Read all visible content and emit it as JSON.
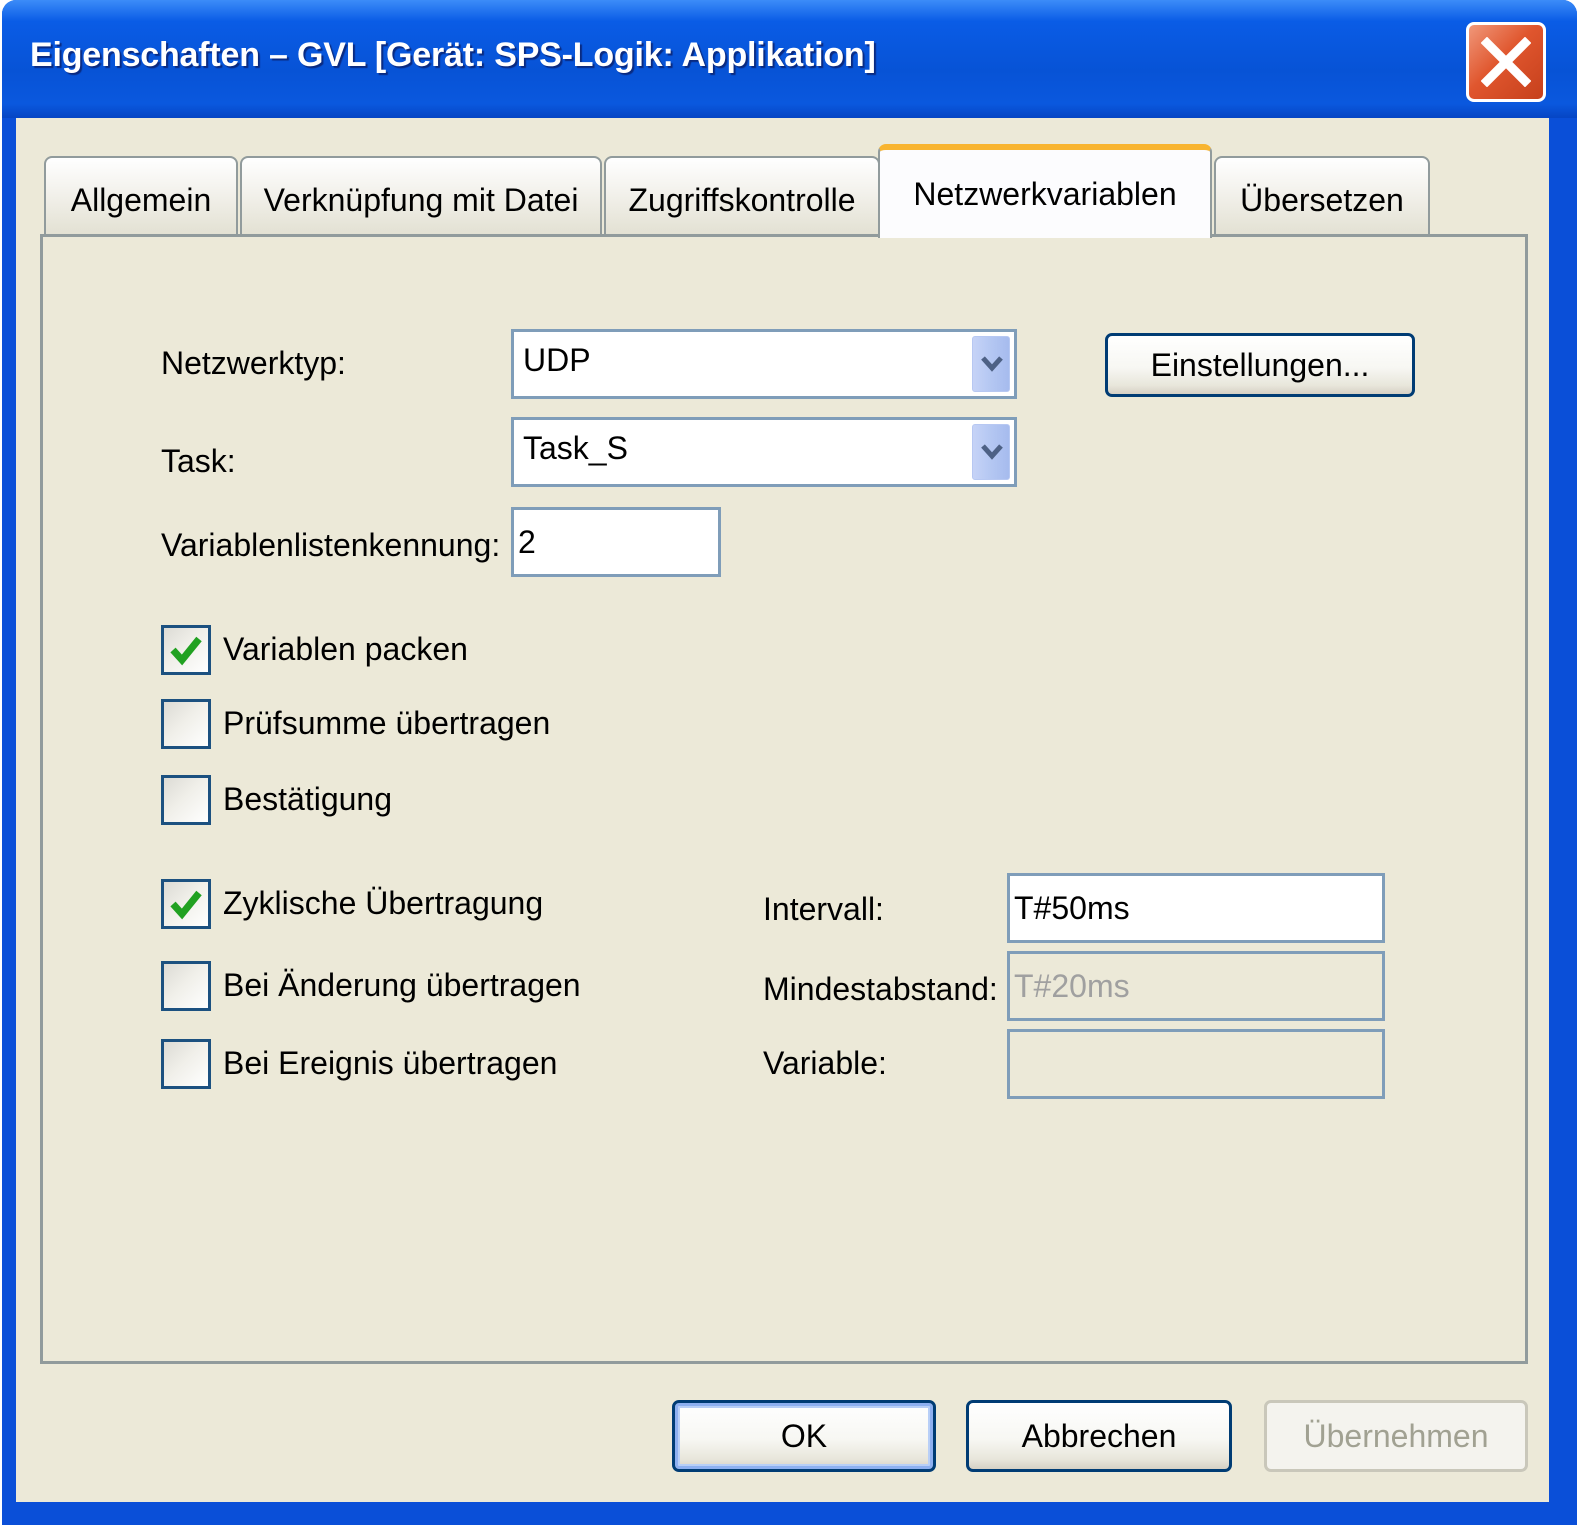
{
  "window": {
    "title": "Eigenschaften – GVL [Gerät: SPS-Logik: Applikation]"
  },
  "tabs": [
    {
      "label": "Allgemein",
      "active": false
    },
    {
      "label": "Verknüpfung mit Datei",
      "active": false
    },
    {
      "label": "Zugriffskontrolle",
      "active": false
    },
    {
      "label": "Netzwerkvariablen",
      "active": true
    },
    {
      "label": "Übersetzen",
      "active": false
    }
  ],
  "form": {
    "network_type": {
      "label": "Netzwerktyp:",
      "value": "UDP"
    },
    "settings_button": "Einstellungen...",
    "task": {
      "label": "Task:",
      "value": "Task_S"
    },
    "list_id": {
      "label": "Variablenlistenkennung:",
      "value": "2"
    },
    "checkboxes": [
      {
        "label": "Variablen packen",
        "checked": true
      },
      {
        "label": "Prüfsumme übertragen",
        "checked": false
      },
      {
        "label": "Bestätigung",
        "checked": false
      }
    ],
    "transmit": [
      {
        "label": "Zyklische Übertragung",
        "checked": true
      },
      {
        "label": "Bei Änderung übertragen",
        "checked": false
      },
      {
        "label": "Bei Ereignis übertragen",
        "checked": false
      }
    ],
    "interval": {
      "label": "Intervall:",
      "value": "T#50ms"
    },
    "min_gap": {
      "label": "Mindestabstand:",
      "value": "T#20ms"
    },
    "variable": {
      "label": "Variable:",
      "value": ""
    }
  },
  "buttons": {
    "ok": "OK",
    "cancel": "Abbrechen",
    "apply": "Übernehmen"
  },
  "colors": {
    "titlebar": "#0a5ce6",
    "active_tab_accent": "#f8b430",
    "check_mark": "#21a121",
    "dialog_bg": "#ece9d8"
  }
}
